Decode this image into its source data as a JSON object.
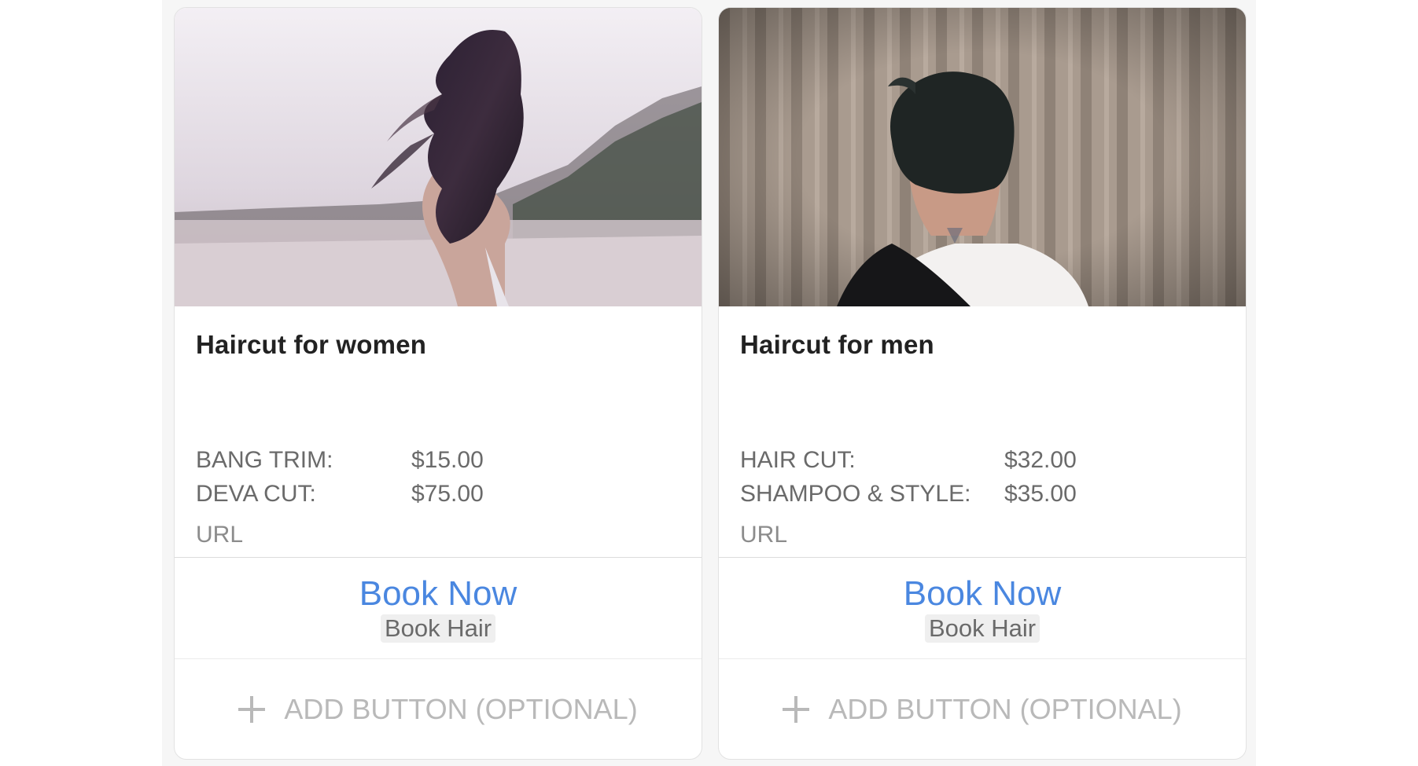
{
  "cards": [
    {
      "image_alt": "woman-with-long-hair-on-beach",
      "title": "Haircut for women",
      "items": [
        {
          "name": "BANG TRIM:",
          "price": "$15.00"
        },
        {
          "name": "DEVA CUT:",
          "price": "$75.00"
        }
      ],
      "url_label": "URL",
      "book_button": {
        "label": "Book Now",
        "tag": "Book Hair"
      },
      "add_button": {
        "label": "ADD BUTTON (OPTIONAL)",
        "icon": "plus-icon"
      }
    },
    {
      "image_alt": "man-short-hair-from-behind",
      "title": "Haircut for men",
      "items": [
        {
          "name": "HAIR CUT:",
          "price": "$32.00"
        },
        {
          "name": "SHAMPOO & STYLE:",
          "price": "$35.00"
        }
      ],
      "url_label": "URL",
      "book_button": {
        "label": "Book Now",
        "tag": "Book Hair"
      },
      "add_button": {
        "label": "ADD BUTTON (OPTIONAL)",
        "icon": "plus-icon"
      }
    }
  ],
  "colors": {
    "accent_link": "#4a87e0",
    "muted_text": "#6a6a6a",
    "placeholder_text": "#b9b9b9"
  }
}
